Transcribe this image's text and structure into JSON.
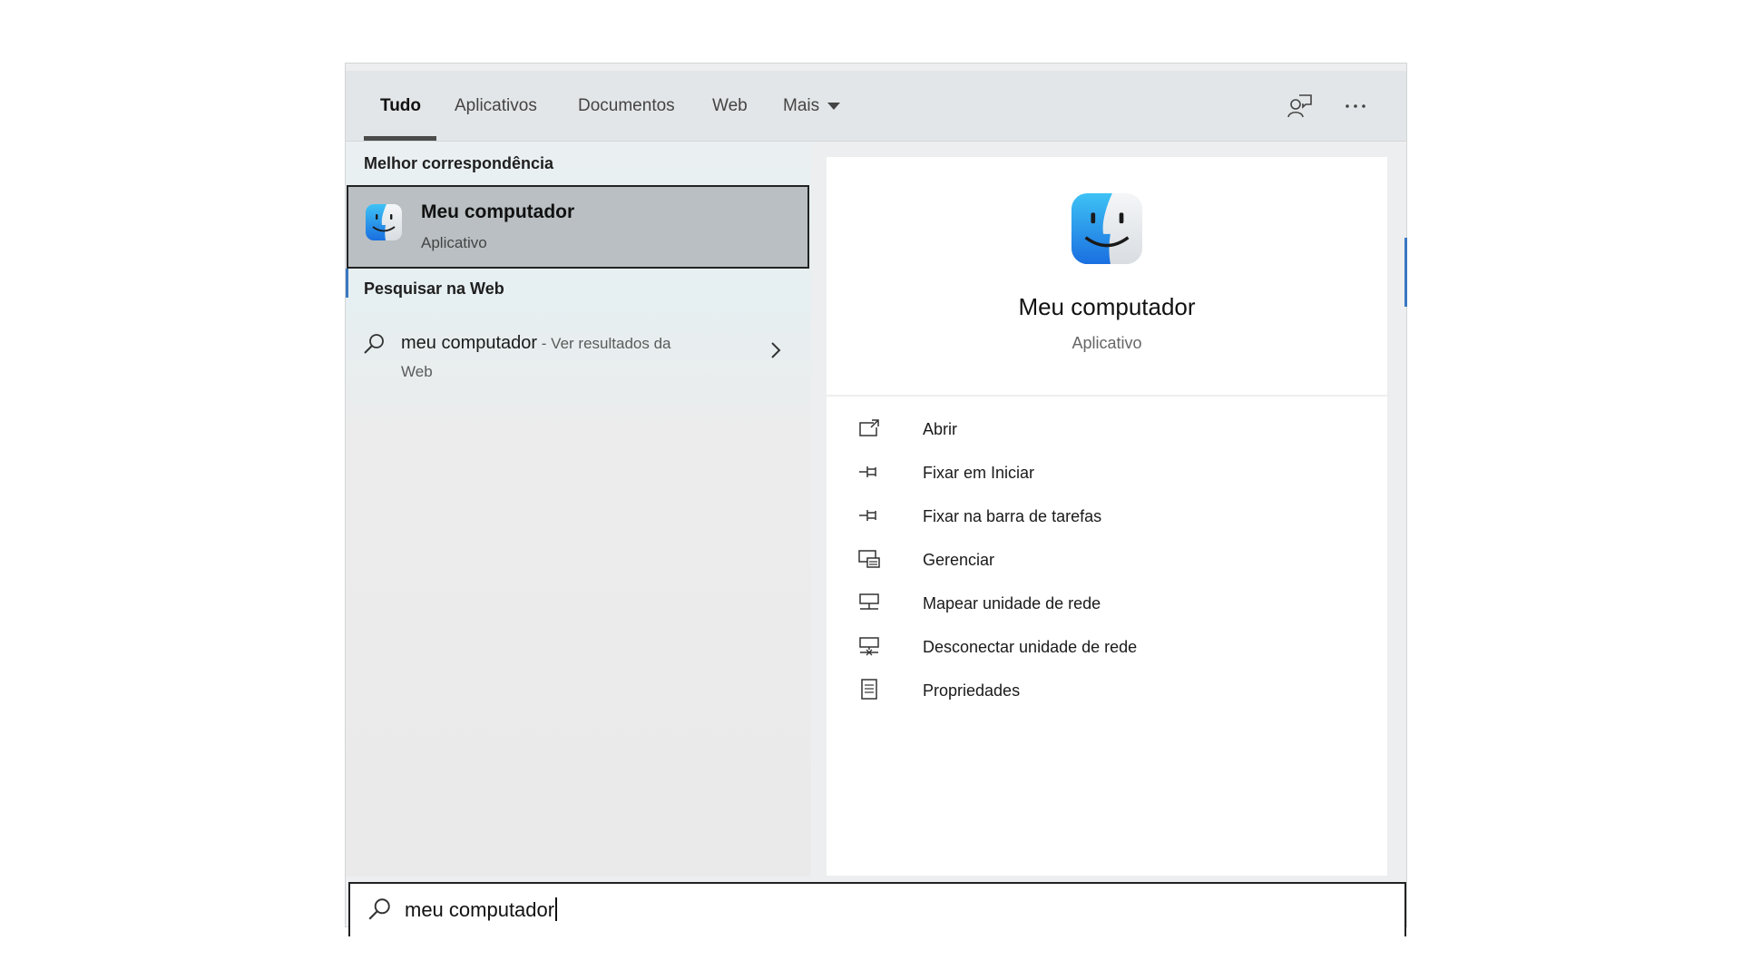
{
  "tabs": [
    {
      "label": "Tudo",
      "active": true
    },
    {
      "label": "Aplicativos"
    },
    {
      "label": "Documentos"
    },
    {
      "label": "Web"
    },
    {
      "label": "Mais"
    }
  ],
  "header_icons": [
    "feedback-icon",
    "more-options-icon"
  ],
  "results": {
    "best_match_title": "Melhor correspondência",
    "best_match": {
      "name": "Meu computador",
      "type": "Aplicativo",
      "icon": "finder-app-icon"
    },
    "web_title": "Pesquisar na Web",
    "web_result": {
      "query": "meu computador",
      "suffix": " - Ver resultados da",
      "suffix_line2": "Web"
    }
  },
  "preview": {
    "app_name": "Meu computador",
    "app_type": "Aplicativo",
    "actions": [
      {
        "label": "Abrir",
        "icon": "open-icon"
      },
      {
        "label": "Fixar em Iniciar",
        "icon": "pin-icon"
      },
      {
        "label": "Fixar na barra de tarefas",
        "icon": "pin-icon"
      },
      {
        "label": "Gerenciar",
        "icon": "manage-icon"
      },
      {
        "label": "Mapear unidade de rede",
        "icon": "map-network-drive-icon"
      },
      {
        "label": "Desconectar unidade de rede",
        "icon": "disconnect-network-drive-icon"
      },
      {
        "label": "Propriedades",
        "icon": "properties-icon"
      }
    ]
  },
  "search": {
    "value": "meu computador"
  },
  "colors": {
    "accent": "#3a78c2",
    "selected": "#b9bfc2",
    "panel": "#eceeef"
  }
}
